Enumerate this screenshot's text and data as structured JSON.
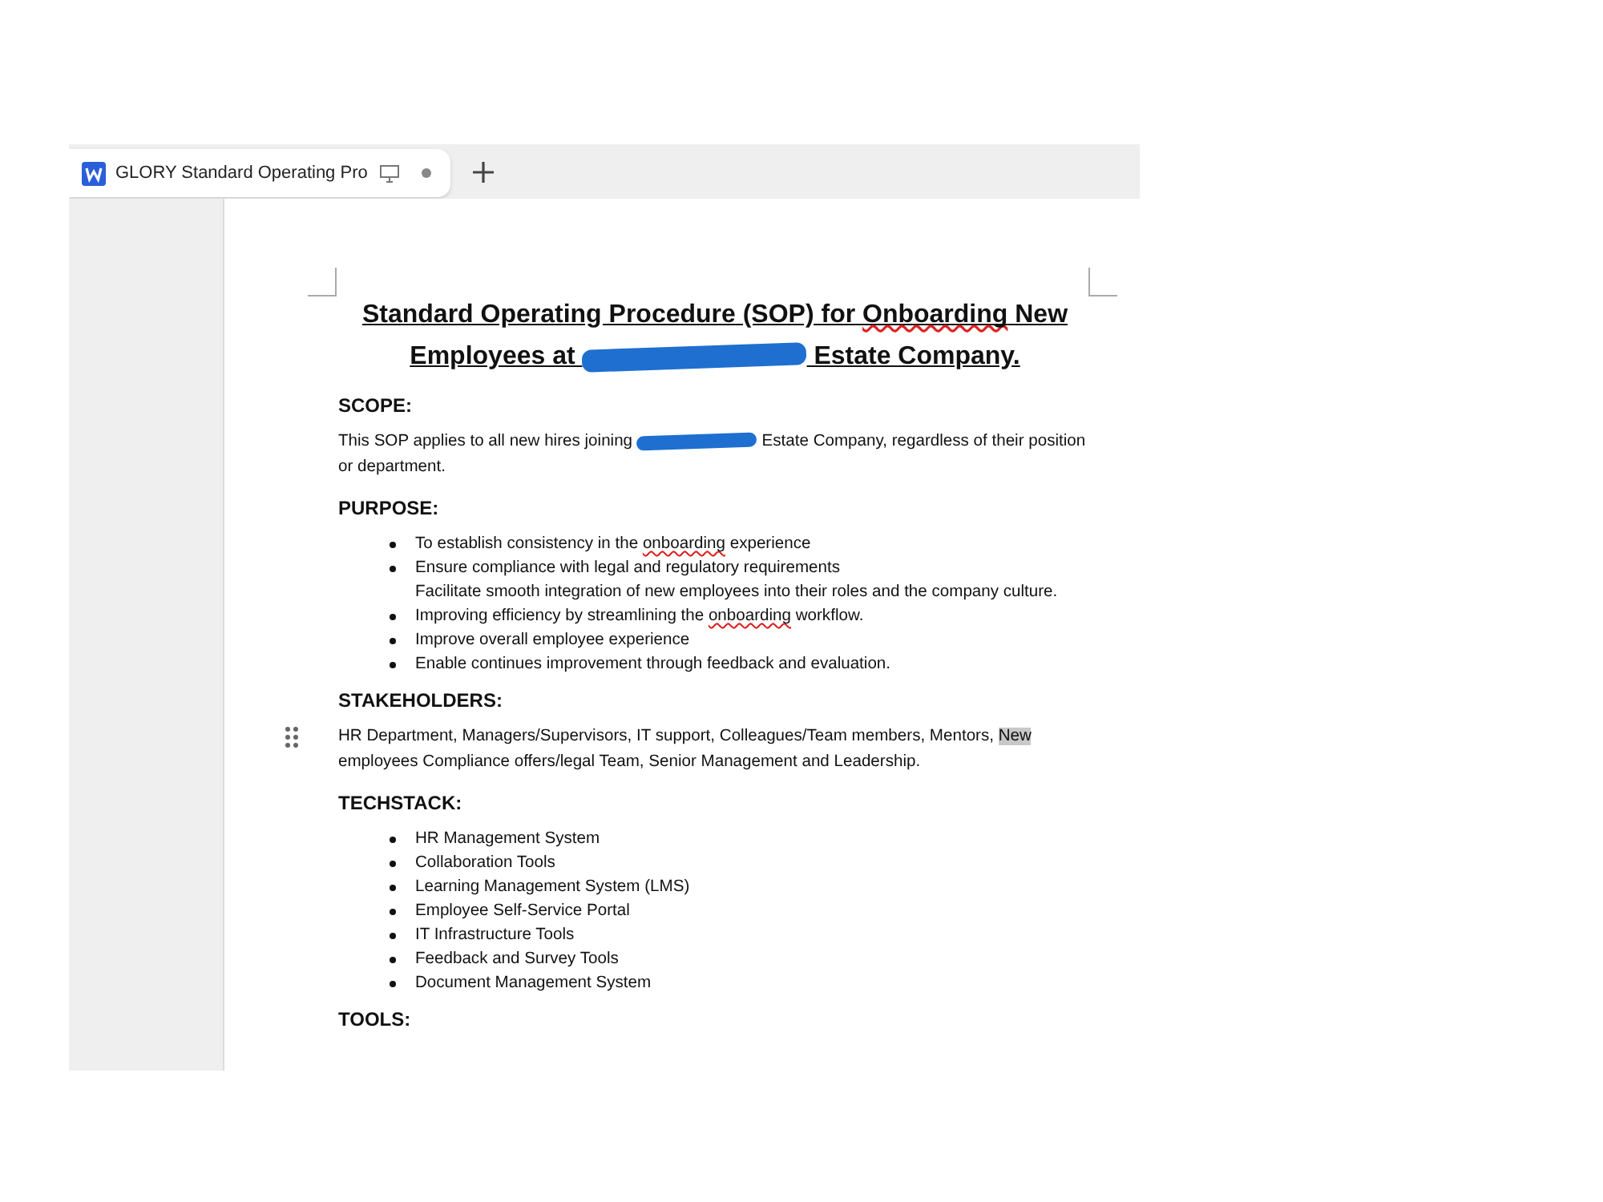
{
  "tab": {
    "title": "GLORY Standard Operating Pro",
    "unsaved": true
  },
  "document": {
    "title_line_1": [
      {
        "text": "Standard Operating Procedure (SOP) for ",
        "spelling_error": false
      },
      {
        "text": "Onboarding",
        "spelling_error": true
      },
      {
        "text": " New",
        "spelling_error": false
      }
    ],
    "title_line_2": {
      "before": "Employees at",
      "after": "Estate Company."
    },
    "sections": [
      {
        "heading": "SCOPE:",
        "kind": "paragraph",
        "before": "This SOP applies to all new hires joining",
        "after": "Estate Company, regardless of their position or department."
      },
      {
        "heading": "PURPOSE:",
        "kind": "list",
        "items": [
          {
            "kind": "bullet",
            "segments": [
              {
                "text": "To establish consistency in the ",
                "spelling_error": false
              },
              {
                "text": "onboarding",
                "spelling_error": true
              },
              {
                "text": " experience",
                "spelling_error": false
              }
            ]
          },
          {
            "kind": "bullet",
            "segments": [
              {
                "text": "Ensure compliance with legal and regulatory requirements",
                "spelling_error": false
              }
            ]
          },
          {
            "kind": "continuation",
            "segments": [
              {
                "text": "Facilitate smooth  integration of new employees into their roles and the company culture.",
                "spelling_error": false
              }
            ]
          },
          {
            "kind": "bullet",
            "segments": [
              {
                "text": "Improving efficiency by streamlining the ",
                "spelling_error": false
              },
              {
                "text": "onboarding",
                "spelling_error": true
              },
              {
                "text": " workflow.",
                "spelling_error": false
              }
            ]
          },
          {
            "kind": "bullet",
            "segments": [
              {
                "text": "Improve overall employee experience",
                "spelling_error": false
              }
            ]
          },
          {
            "kind": "bullet",
            "segments": [
              {
                "text": "Enable continues improvement through feedback and evaluation.",
                "spelling_error": false
              }
            ]
          }
        ]
      },
      {
        "heading": "STAKEHOLDERS:",
        "kind": "selection",
        "segments": [
          {
            "text": "HR Department, Managers/Supervisors, IT support, Colleagues/Team members, Mentors, ",
            "selected": false
          },
          {
            "text": "New",
            "selected": true
          },
          {
            "text": " employees Compliance offers/legal Team, Senior Management and Leadership.",
            "selected": false
          }
        ]
      },
      {
        "heading": "TECHSTACK:",
        "kind": "list",
        "items": [
          {
            "kind": "bullet",
            "segments": [
              {
                "text": "HR Management System",
                "spelling_error": false
              }
            ]
          },
          {
            "kind": "bullet",
            "segments": [
              {
                "text": "Collaboration Tools",
                "spelling_error": false
              }
            ]
          },
          {
            "kind": "bullet",
            "segments": [
              {
                "text": "Learning Management System (LMS)",
                "spelling_error": false
              }
            ]
          },
          {
            "kind": "bullet",
            "segments": [
              {
                "text": "Employee Self-Service Portal",
                "spelling_error": false
              }
            ]
          },
          {
            "kind": "bullet",
            "segments": [
              {
                "text": "IT Infrastructure Tools",
                "spelling_error": false
              }
            ]
          },
          {
            "kind": "bullet",
            "segments": [
              {
                "text": "Feedback and Survey Tools",
                "spelling_error": false
              }
            ]
          },
          {
            "kind": "bullet",
            "segments": [
              {
                "text": "Document Management System",
                "spelling_error": false
              }
            ]
          }
        ]
      },
      {
        "heading": "TOOLS:",
        "kind": "heading_only"
      }
    ]
  }
}
